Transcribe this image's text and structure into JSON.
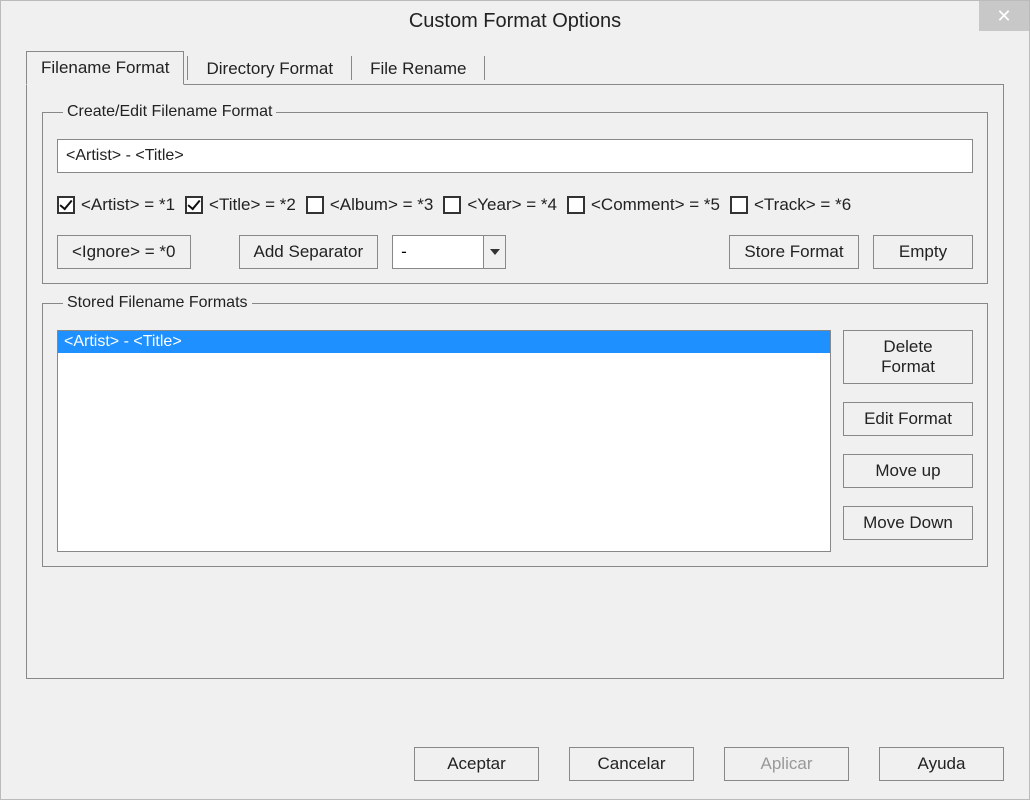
{
  "window": {
    "title": "Custom Format Options",
    "close_glyph": "✕"
  },
  "tabs": {
    "active": 0,
    "items": [
      "Filename Format",
      "Directory Format",
      "File Rename"
    ]
  },
  "group_create": {
    "legend": "Create/Edit Filename Format",
    "format_value": "<Artist> - <Title>",
    "checks": [
      {
        "label": "<Artist> = *1",
        "checked": true
      },
      {
        "label": "<Title> = *2",
        "checked": true
      },
      {
        "label": "<Album> = *3",
        "checked": false
      },
      {
        "label": "<Year> = *4",
        "checked": false
      },
      {
        "label": "<Comment> = *5",
        "checked": false
      },
      {
        "label": "<Track> = *6",
        "checked": false
      }
    ],
    "ignore_btn": "<Ignore> = *0",
    "add_sep_btn": "Add Separator",
    "separator_value": "-",
    "store_btn": "Store Format",
    "empty_btn": "Empty"
  },
  "group_stored": {
    "legend": "Stored Filename Formats",
    "items": [
      {
        "text": "<Artist> - <Title>",
        "selected": true
      }
    ],
    "buttons": {
      "delete": "Delete Format",
      "edit": "Edit Format",
      "up": "Move up",
      "down": "Move Down"
    }
  },
  "bottom": {
    "accept": "Aceptar",
    "cancel": "Cancelar",
    "apply": "Aplicar",
    "help": "Ayuda"
  }
}
